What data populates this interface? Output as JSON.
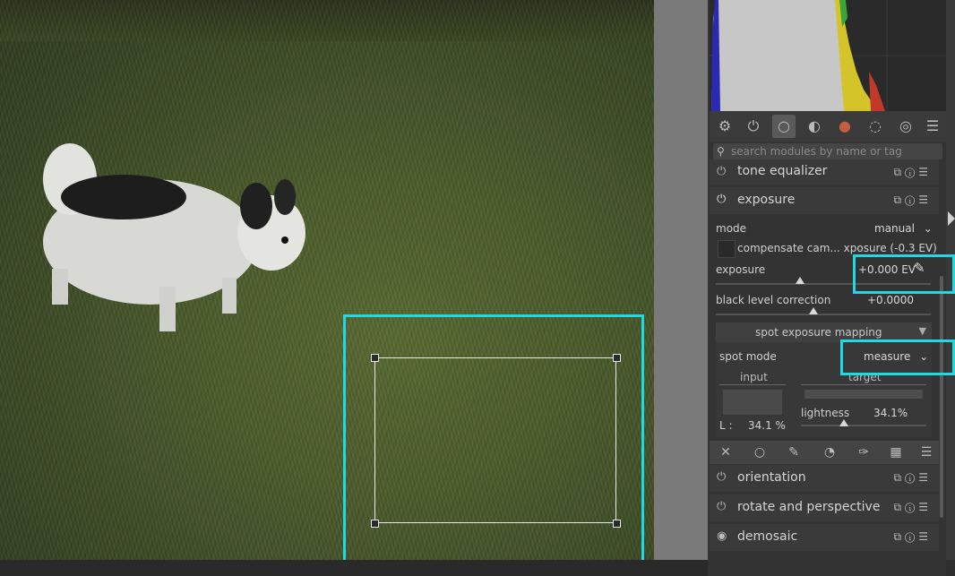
{
  "search": {
    "placeholder": "search modules by name or tag"
  },
  "tabs": [
    {
      "icon": "sliders-icon",
      "glyph": "⚙"
    },
    {
      "icon": "power-icon",
      "glyph": "⏻"
    },
    {
      "icon": "circle-icon",
      "glyph": "○"
    },
    {
      "icon": "gradient-circle-icon",
      "glyph": "◐"
    },
    {
      "icon": "color-wheel-icon",
      "glyph": "●"
    },
    {
      "icon": "curve-icon",
      "glyph": "◌"
    },
    {
      "icon": "lens-icon",
      "glyph": "◎"
    },
    {
      "icon": "menu-icon",
      "glyph": "☰"
    }
  ],
  "modules": {
    "tone_equalizer": {
      "label": "tone equalizer"
    },
    "exposure": {
      "label": "exposure",
      "mode_label": "mode",
      "mode_value": "manual",
      "compensate_label": "compensate cam... xposure (-0.3 EV)",
      "exposure_label": "exposure",
      "exposure_value": "+0.000 EV",
      "black_label": "black level correction",
      "black_value": "+0.0000",
      "spot": {
        "section_title": "spot exposure mapping",
        "mode_label": "spot mode",
        "mode_value": "measure",
        "input_label": "input",
        "target_label": "target",
        "l_label": "L :",
        "l_value": "34.1 %",
        "lightness_label": "lightness",
        "lightness_value": "34.1%",
        "lightness_fraction": 0.341
      }
    },
    "orientation": {
      "label": "orientation"
    },
    "rotate": {
      "label": "rotate and perspective"
    },
    "demosaic": {
      "label": "demosaic"
    }
  },
  "colors": {
    "highlight": "#1fd9e6",
    "panel_bg": "#333333",
    "histogram_red": "#c0392b",
    "histogram_yellow": "#d4c42a",
    "histogram_green": "#3aa63a",
    "histogram_blue": "#2a2ab0"
  }
}
